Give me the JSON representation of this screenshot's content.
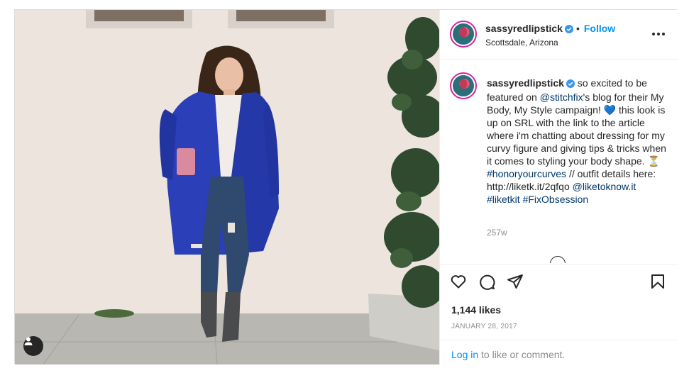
{
  "colors": {
    "accent": "#0095f6",
    "link": "#00376b",
    "muted": "#8e8e8e",
    "text": "#262626",
    "coat": "#2a3fb8"
  },
  "post": {
    "photo_alt": "Woman in a cobalt blue coat and ripped jeans standing in front of a beige wall",
    "tag_icon": "user-tag-icon"
  },
  "header": {
    "username": "sassyredlipstick",
    "verified_icon": "verified-badge-icon",
    "separator": "•",
    "follow_label": "Follow",
    "location": "Scottsdale, Arizona",
    "more_icon": "more-options-icon"
  },
  "caption": {
    "username": "sassyredlipstick",
    "seg1": " so excited to be featured on ",
    "mention1": "@stitchfix",
    "seg2": "'s blog for their My Body, My Style campaign! 💙 this look is up on SRL with the link to the article where i'm chatting about dressing for my curvy figure and giving tips & tricks when it comes to styling your body shape. ⏳ ",
    "hashtag1": "#honoryourcurves",
    "seg3": " // outfit details here: http://liketk.it/2qfqo ",
    "mention2": "@liketoknow.it",
    "seg4": " ",
    "hashtag2": "#liketkit",
    "seg5": " ",
    "hashtag3": "#FixObsession",
    "age": "257w"
  },
  "actions": {
    "like_icon": "heart-icon",
    "comment_icon": "comment-icon",
    "share_icon": "share-icon",
    "save_icon": "bookmark-icon"
  },
  "likes": "1,144 likes",
  "date": "JANUARY 28, 2017",
  "login": {
    "link": "Log in",
    "rest": " to like or comment."
  }
}
